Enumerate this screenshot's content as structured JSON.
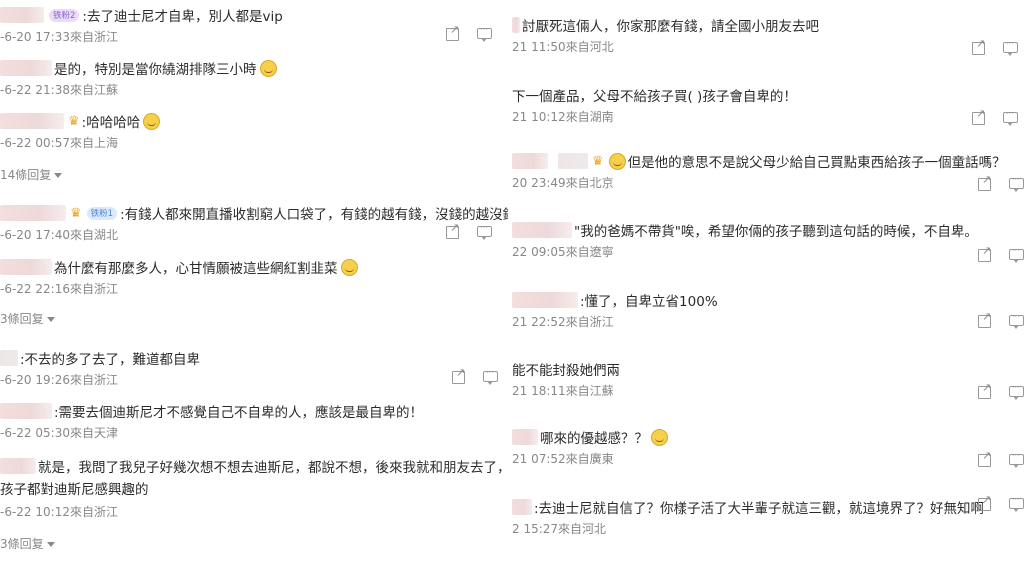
{
  "left": {
    "comments": [
      {
        "text": ":去了迪士尼才自卑，別人都是vip",
        "badge": "铁粉2",
        "meta": "-6-20 17:33來自浙江"
      },
      {
        "text": "是的，特別是當你繞湖排隊三小時",
        "meta": "-6-22 21:38來自江蘇"
      },
      {
        "text": ":哈哈哈哈",
        "meta": "-6-22 00:57來自上海",
        "reply": "14條回复"
      },
      {
        "text": ":有錢人都來開直播收割窮人口袋了，有錢的越有錢，沒錢的越沒錢",
        "badge": "铁粉1",
        "meta": "-6-20 17:40來自湖北"
      },
      {
        "text": "為什麼有那麼多人，心甘情願被這些網紅割韭菜",
        "meta": "-6-22 22:16來自浙江",
        "reply": "3條回复"
      },
      {
        "text": ":不去的多了去了，難道都自卑",
        "meta": "-6-20 19:26來自浙江"
      },
      {
        "text": ":需要去個迪斯尼才不感覺自己不自卑的人，應該是最自卑的！",
        "meta": "-6-22 05:30來自天津"
      },
      {
        "text": "就是，我問了我兒子好幾次想不想去迪斯尼，都說不想，後來我就和朋友去了，",
        "text2": "孩子都對迪斯尼感興趣的",
        "meta": "-6-22 10:12來自浙江",
        "reply": "3條回复"
      }
    ]
  },
  "right": {
    "comments": [
      {
        "text": "討厭死這倆人，你家那麼有錢，請全國小朋友去吧",
        "meta": "21 11:50來自河北"
      },
      {
        "text": "下一個產品，父母不給孩子買(  )孩子會自卑的！",
        "meta": "21 10:12來自湖南"
      },
      {
        "text": "但是他的意思不是說父母少給自己買點東西給孩子一個童話嗎？",
        "meta": "20 23:49來自北京"
      },
      {
        "text": "\"我的爸媽不帶貨\"唉，希望你倆的孩子聽到這句話的時候，不自卑。",
        "meta": "22 09:05來自遼寧"
      },
      {
        "text": ":懂了，自卑立省100%",
        "meta": "21 22:52來自浙江"
      },
      {
        "text": "能不能封殺她們兩",
        "meta": "21 18:11來自江蘇"
      },
      {
        "text": "哪來的優越感？？",
        "meta": "21 07:52來自廣東"
      },
      {
        "text": ":去迪士尼就自信了？你樣子活了大半輩子就這三觀，就這境界了？好無知啊",
        "meta": "2 15:27來自河北"
      }
    ]
  }
}
